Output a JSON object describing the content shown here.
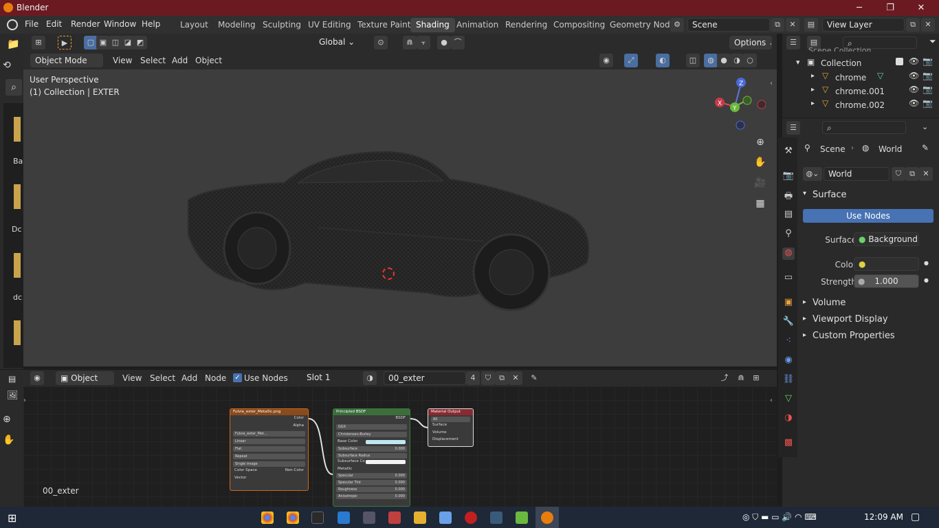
{
  "window": {
    "title": "Blender",
    "minimize": "─",
    "maximize": "❐",
    "close": "✕"
  },
  "menu": {
    "file": "File",
    "edit": "Edit",
    "render": "Render",
    "window": "Window",
    "help": "Help"
  },
  "workspaces": [
    "Layout",
    "Modeling",
    "Sculpting",
    "UV Editing",
    "Texture Paint",
    "Shading",
    "Animation",
    "Rendering",
    "Compositing",
    "Geometry Nod"
  ],
  "active_workspace": "Shading",
  "scene": {
    "name": "Scene",
    "view_layer": "View Layer"
  },
  "toolbar": {
    "orientation": "Global",
    "options": "Options"
  },
  "viewport_header": {
    "mode": "Object Mode",
    "view": "View",
    "select": "Select",
    "add": "Add",
    "object": "Object"
  },
  "viewport": {
    "perspective": "User Perspective",
    "collection_info": "(1) Collection | EXTER",
    "gizmo": {
      "z": "Z",
      "x": "X",
      "y": "Y"
    }
  },
  "outliner": {
    "top_cut": "Scene Collection",
    "collection": "Collection",
    "items": [
      "chrome",
      "chrome.001",
      "chrome.002"
    ]
  },
  "properties": {
    "breadcrumb_scene": "Scene",
    "breadcrumb_world": "World",
    "world_name": "World",
    "surface_section": "Surface",
    "use_nodes": "Use Nodes",
    "surface_label": "Surface",
    "surface_value": "Background",
    "color_label": "Color",
    "strength_label": "Strength",
    "strength_value": "1.000",
    "volume": "Volume",
    "viewport_display": "Viewport Display",
    "custom_properties": "Custom Properties"
  },
  "thumbnails": [
    "Ba",
    "Dc",
    "dc"
  ],
  "node_header": {
    "object": "Object",
    "view": "View",
    "select": "Select",
    "add": "Add",
    "node": "Node",
    "use_nodes": "Use Nodes",
    "slot": "Slot 1",
    "material": "00_exter",
    "users": "4"
  },
  "node_editor": {
    "material_label": "00_exter",
    "image_node": {
      "title": "Fulvia_exter_Metallic.png",
      "out_color": "Color",
      "out_alpha": "Alpha",
      "image": "Fulvia_exter_Met...",
      "interp": "Linear",
      "proj": "Flat",
      "ext": "Repeat",
      "source": "Single Image",
      "cs_label": "Color Space",
      "cs_value": "Non-Color",
      "vector": "Vector"
    },
    "bsdf_node": {
      "title": "Principled BSDF",
      "out": "BSDF",
      "dist": "GGX",
      "sss": "Christensen-Burley",
      "rows": [
        [
          "Base Color",
          ""
        ],
        [
          "Subsurface",
          "0.000"
        ],
        [
          "Subsurface Radius",
          ""
        ],
        [
          "Subsurface Co",
          ""
        ],
        [
          "Metallic",
          ""
        ],
        [
          "Specular",
          "0.000"
        ],
        [
          "Specular Tint",
          "0.000"
        ],
        [
          "Roughness",
          "0.000"
        ],
        [
          "Anisotropic",
          "0.000"
        ]
      ]
    },
    "output_node": {
      "title": "Material Output",
      "target": "All",
      "inputs": [
        "Surface",
        "Volume",
        "Displacement"
      ]
    }
  },
  "taskbar": {
    "time": "12:09 AM"
  }
}
